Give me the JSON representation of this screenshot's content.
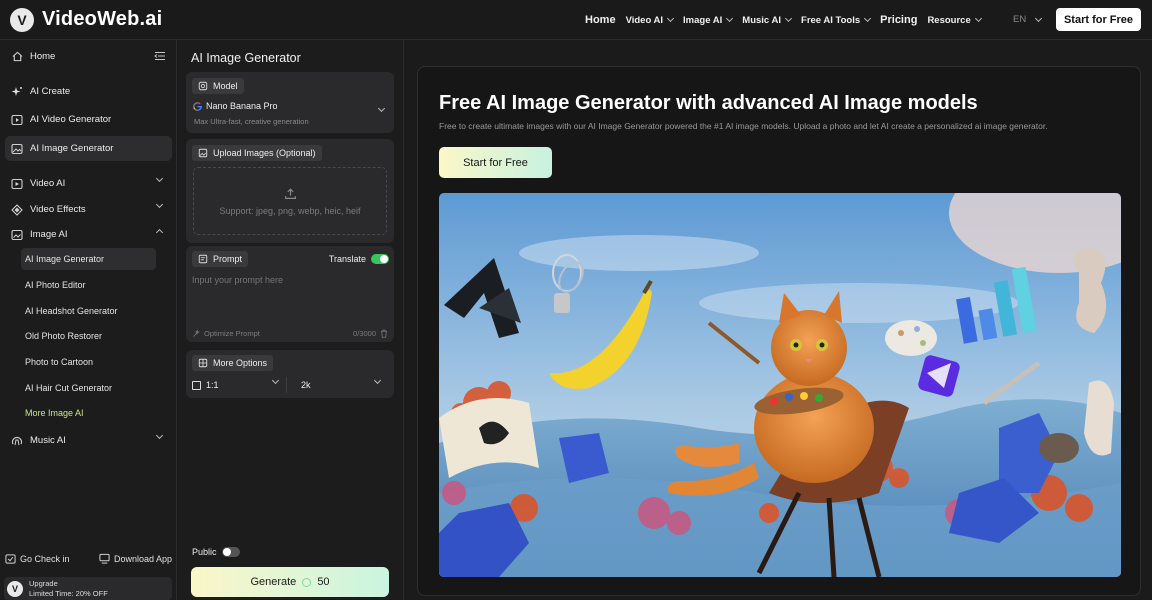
{
  "brand": {
    "name": "VideoWeb.ai",
    "badge": "V"
  },
  "topnav": {
    "items": [
      {
        "label": "Home",
        "chevron": false,
        "big": true
      },
      {
        "label": "Video AI",
        "chevron": true,
        "big": false
      },
      {
        "label": "Image AI",
        "chevron": true,
        "big": false
      },
      {
        "label": "Music AI",
        "chevron": true,
        "big": false
      },
      {
        "label": "Free AI Tools",
        "chevron": true,
        "big": false
      },
      {
        "label": "Pricing",
        "chevron": false,
        "big": true
      },
      {
        "label": "Resource",
        "chevron": true,
        "big": false
      }
    ],
    "lang": "EN",
    "cta": "Start for Free"
  },
  "sidebar": {
    "home": "Home",
    "ai_create": "AI Create",
    "ai_video_generator": "AI Video Generator",
    "ai_image_generator": "AI Image Generator",
    "video_ai": "Video AI",
    "video_effects": "Video Effects",
    "image_ai": "Image AI",
    "image_ai_sub": [
      "AI Image Generator",
      "AI Photo Editor",
      "AI Headshot Generator",
      "Old Photo Restorer",
      "Photo to Cartoon",
      "AI Hair Cut Generator",
      "More Image AI"
    ],
    "music_ai": "Music AI",
    "go_check_in": "Go Check in",
    "download_app": "Download App",
    "upgrade_title": "Upgrade",
    "upgrade_offer": "Limited Time: 20% OFF"
  },
  "panel": {
    "title": "AI Image Generator",
    "model_label": "Model",
    "model_name": "Nano Banana Pro",
    "model_desc": "Max Ultra-fast, creative generation",
    "upload_label": "Upload Images (Optional)",
    "upload_support": "Support: jpeg, png, webp, heic, heif",
    "prompt_label": "Prompt",
    "translate_label": "Translate",
    "translate_on": true,
    "prompt_placeholder": "Input your prompt here",
    "optimize_label": "Optimize Prompt",
    "char_count": "0/3000",
    "more_options_label": "More Options",
    "aspect_ratio": "1:1",
    "resolution": "2k",
    "public_label": "Public",
    "public_on": false,
    "generate_label": "Generate",
    "generate_cost": "50"
  },
  "hero": {
    "title": "Free AI Image Generator with advanced AI Image models",
    "subtitle": "Free to create ultimate images with our AI Image Generator powered the #1 AI image models. Upload a photo and let AI create a personalized ai image generator.",
    "cta": "Start for Free"
  },
  "colors": {
    "background": "#1b1b1c",
    "accent_green": "#34c759",
    "gradient_start": "#fbf6c8",
    "gradient_end": "#c9f5e0",
    "more_link": "#c9e58b"
  },
  "icons": [
    "home-icon",
    "collapse-sidebar-icon",
    "sparkle-icon",
    "video-icon",
    "image-icon",
    "video-ai-icon",
    "effects-icon",
    "image-ai-icon",
    "music-icon",
    "check-in-icon",
    "download-icon",
    "model-icon",
    "google-icon",
    "upload-icon",
    "prompt-icon",
    "optimize-icon",
    "trash-icon",
    "options-icon",
    "coin-icon"
  ]
}
